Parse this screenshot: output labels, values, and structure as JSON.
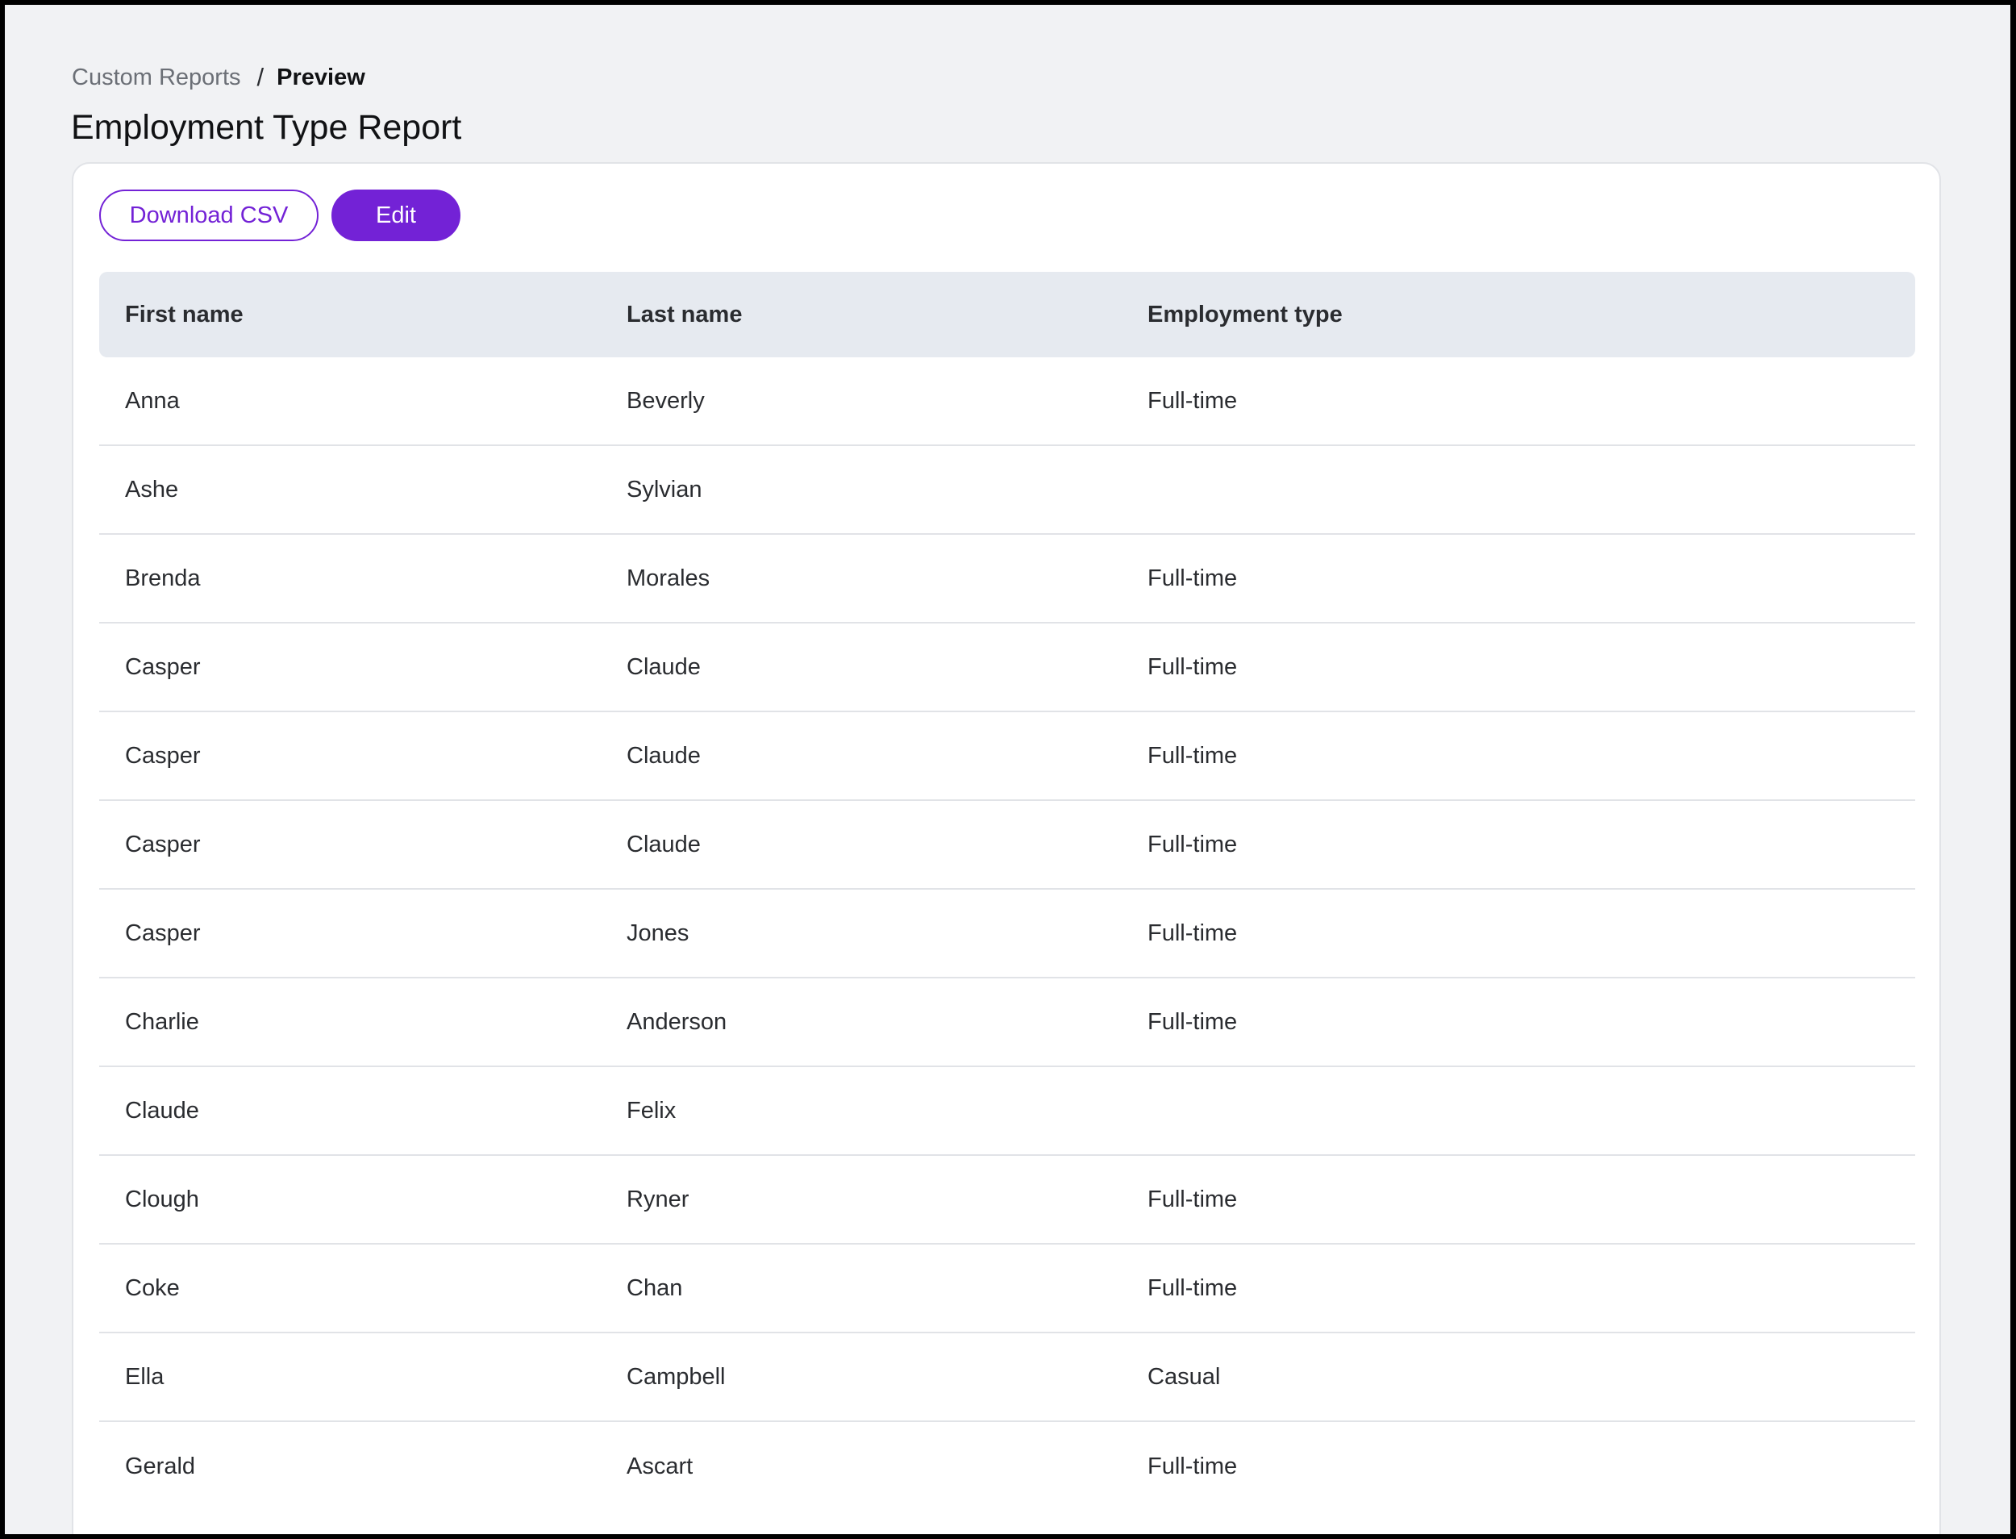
{
  "breadcrumb": {
    "parent": "Custom Reports",
    "separator": "/",
    "current": "Preview"
  },
  "page": {
    "title": "Employment Type Report"
  },
  "toolbar": {
    "download_label": "Download CSV",
    "edit_label": "Edit"
  },
  "colors": {
    "accent": "#7322d6",
    "background": "#f1f2f4",
    "header_row": "#e6eaf0"
  },
  "table": {
    "columns": [
      "First name",
      "Last name",
      "Employment type"
    ],
    "rows": [
      [
        "Anna",
        "Beverly",
        "Full-time"
      ],
      [
        "Ashe",
        "Sylvian",
        ""
      ],
      [
        "Brenda",
        "Morales",
        "Full-time"
      ],
      [
        "Casper",
        "Claude",
        "Full-time"
      ],
      [
        "Casper",
        "Claude",
        "Full-time"
      ],
      [
        "Casper",
        "Claude",
        "Full-time"
      ],
      [
        "Casper",
        "Jones",
        "Full-time"
      ],
      [
        "Charlie",
        "Anderson",
        "Full-time"
      ],
      [
        "Claude",
        "Felix",
        ""
      ],
      [
        "Clough",
        "Ryner",
        "Full-time"
      ],
      [
        "Coke",
        "Chan",
        "Full-time"
      ],
      [
        "Ella",
        "Campbell",
        "Casual"
      ],
      [
        "Gerald",
        "Ascart",
        "Full-time"
      ]
    ]
  }
}
